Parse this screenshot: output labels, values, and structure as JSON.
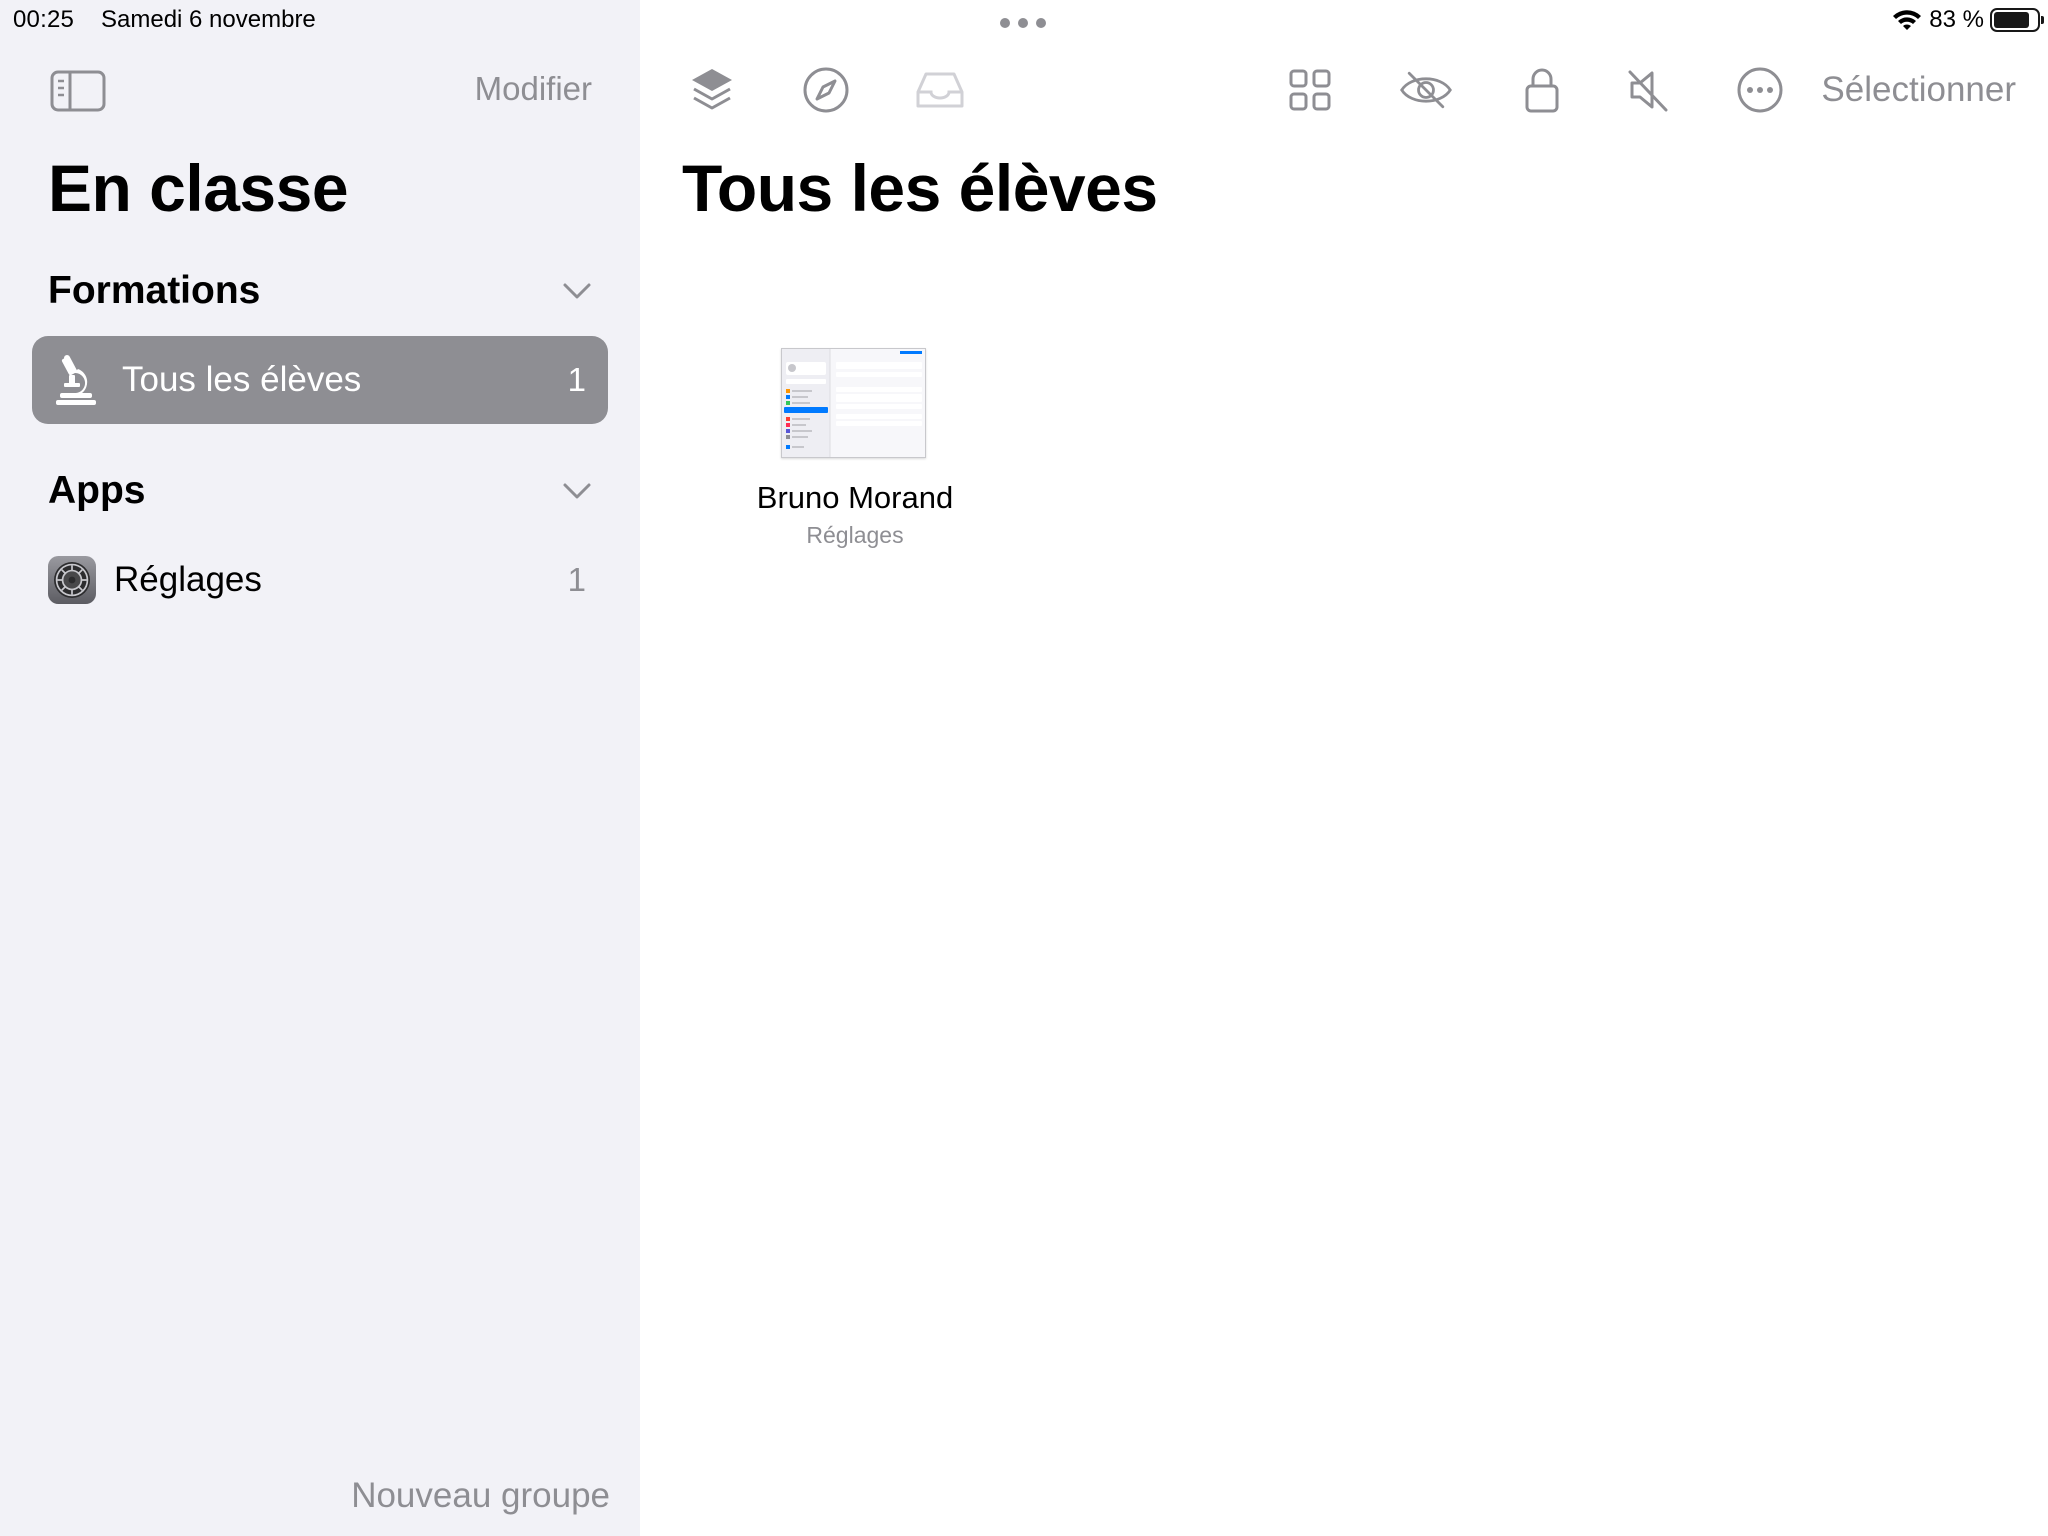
{
  "status_bar": {
    "time": "00:25",
    "date": "Samedi 6 novembre",
    "battery_text": "83 %",
    "battery_level": 0.83
  },
  "sidebar": {
    "edit_label": "Modifier",
    "title": "En classe",
    "sections": [
      {
        "label": "Formations",
        "items": [
          {
            "label": "Tous les élèves",
            "count": "1",
            "icon": "microscope-icon",
            "selected": true
          }
        ]
      },
      {
        "label": "Apps",
        "items": [
          {
            "label": "Réglages",
            "count": "1",
            "icon": "settings-app-icon",
            "selected": false
          }
        ]
      }
    ],
    "new_group_label": "Nouveau groupe"
  },
  "main": {
    "title": "Tous les élèves",
    "toolbar": {
      "icons": [
        "layers-icon",
        "compass-icon",
        "tray-icon",
        "grid-icon",
        "eye-slash-icon",
        "lock-icon",
        "mute-icon",
        "ellipsis-circle-icon"
      ],
      "select_label": "Sélectionner"
    },
    "students": [
      {
        "name": "Bruno Morand",
        "app": "Réglages"
      }
    ]
  },
  "colors": {
    "sidebar_bg": "#f2f2f7",
    "selected_row": "#8e8e93",
    "secondary_text": "#8e8e93",
    "toolbar_icon": "#8e8e93"
  }
}
